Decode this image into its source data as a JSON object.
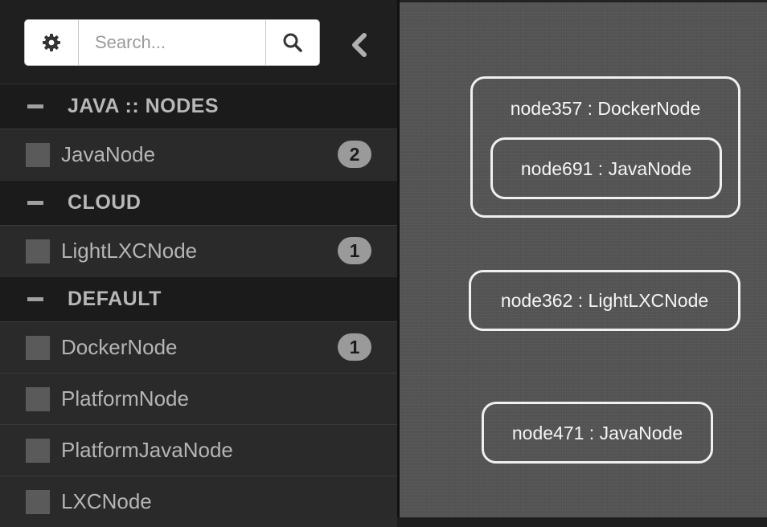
{
  "toolbar": {
    "search_placeholder": "Search...",
    "settings_icon": "gear-icon",
    "search_icon": "search-icon",
    "collapse_icon": "chevron-left-icon"
  },
  "groups": [
    {
      "name": "JAVA :: NODES",
      "toggle": "minus-icon",
      "items": [
        {
          "label": "JavaNode",
          "count": "2"
        }
      ]
    },
    {
      "name": "CLOUD",
      "toggle": "minus-icon",
      "items": [
        {
          "label": "LightLXCNode",
          "count": "1"
        }
      ]
    },
    {
      "name": "DEFAULT",
      "toggle": "minus-icon",
      "items": [
        {
          "label": "DockerNode",
          "count": "1"
        },
        {
          "label": "PlatformNode",
          "count": ""
        },
        {
          "label": "PlatformJavaNode",
          "count": ""
        },
        {
          "label": "LXCNode",
          "count": ""
        }
      ]
    }
  ],
  "canvas": {
    "nodes": [
      {
        "label": "node357 : DockerNode"
      },
      {
        "label": "node691 : JavaNode"
      },
      {
        "label": "node362 : LightLXCNode"
      },
      {
        "label": "node471 : JavaNode"
      }
    ]
  },
  "colors": {
    "sidebar_bg": "#232323",
    "canvas_bg": "#555555",
    "node_border": "#f0f0f0",
    "badge_bg": "#9a9a9a"
  }
}
